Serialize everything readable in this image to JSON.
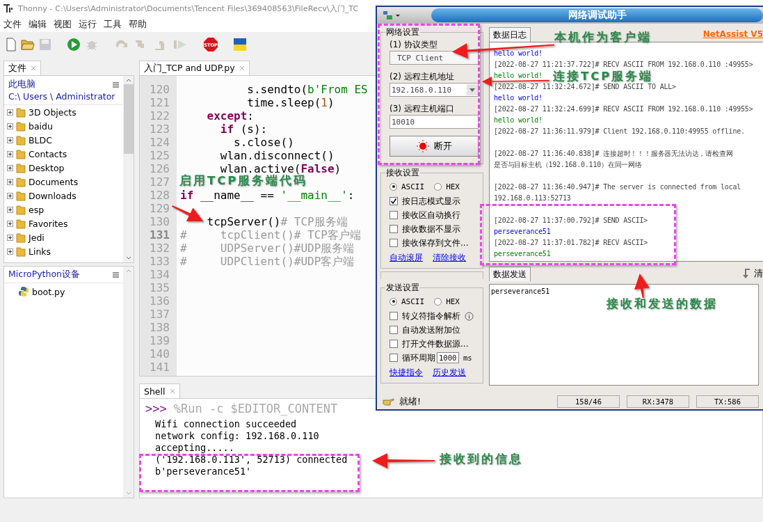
{
  "thonny": {
    "title": "Thonny  -  C:\\Users\\Administrator\\Documents\\Tencent Files\\369408563\\FileRecv\\入门_TC",
    "menu": [
      "文件",
      "编辑",
      "视图",
      "运行",
      "工具",
      "帮助"
    ],
    "toolbar": {
      "stop_label": "STOP"
    },
    "files_panel": {
      "tab": "文件",
      "root": "此电脑",
      "path": "C:\\ Users \\ Administrator",
      "items": [
        "3D Objects",
        "baidu",
        "BLDC",
        "Contacts",
        "Desktop",
        "Documents",
        "Downloads",
        "esp",
        "Favorites",
        "Jedi",
        "Links"
      ]
    },
    "device_panel": {
      "title": "MicroPython设备",
      "items": [
        "boot.py"
      ]
    },
    "editor": {
      "tab": "入门_TCP and UDP.py",
      "lines": [
        {
          "number": "120",
          "current": false,
          "segments": [
            {
              "text": "          s.sendto(",
              "kind": "plain"
            },
            {
              "text": "b'From ES",
              "kind": "string"
            }
          ]
        },
        {
          "number": "121",
          "current": false,
          "segments": [
            {
              "text": "          time.sleep(",
              "kind": "plain"
            },
            {
              "text": "1",
              "kind": "number"
            },
            {
              "text": ")",
              "kind": "plain"
            }
          ]
        },
        {
          "number": "122",
          "current": false,
          "segments": [
            {
              "text": "    except",
              "kind": "keyword"
            },
            {
              "text": ":",
              "kind": "plain"
            }
          ]
        },
        {
          "number": "123",
          "current": false,
          "segments": [
            {
              "text": "      if",
              "kind": "keyword"
            },
            {
              "text": " (s):",
              "kind": "plain"
            }
          ]
        },
        {
          "number": "124",
          "current": false,
          "segments": [
            {
              "text": "        s.close()",
              "kind": "plain"
            }
          ]
        },
        {
          "number": "125",
          "current": false,
          "segments": [
            {
              "text": "      wlan.disconnect()",
              "kind": "plain"
            }
          ]
        },
        {
          "number": "126",
          "current": false,
          "segments": [
            {
              "text": "      wlan.active(",
              "kind": "plain"
            },
            {
              "text": "False",
              "kind": "keyword"
            },
            {
              "text": ")",
              "kind": "plain"
            }
          ]
        },
        {
          "number": "127",
          "current": false
        },
        {
          "number": "128",
          "current": false,
          "segments": [
            {
              "text": "if",
              "kind": "keyword"
            },
            {
              "text": " __name__ == ",
              "kind": "plain"
            },
            {
              "text": "'__main__'",
              "kind": "string"
            },
            {
              "text": ":",
              "kind": "plain"
            }
          ]
        },
        {
          "number": "129",
          "current": false
        },
        {
          "number": "130",
          "current": false,
          "segments": [
            {
              "text": "    tcpServer()",
              "kind": "plain"
            },
            {
              "text": "# TCP服务端",
              "kind": "comment"
            }
          ]
        },
        {
          "number": "131",
          "current": true,
          "segments": [
            {
              "text": "#     tcpClient()# TCP客户端",
              "kind": "comment"
            }
          ]
        },
        {
          "number": "132",
          "current": false,
          "segments": [
            {
              "text": "#     UDPServer()#UDP服务端",
              "kind": "comment"
            }
          ]
        },
        {
          "number": "133",
          "current": false,
          "segments": [
            {
              "text": "#     UDPClient()#UDP客户端",
              "kind": "comment"
            }
          ]
        },
        {
          "number": "134",
          "current": false
        },
        {
          "number": "135",
          "current": false
        },
        {
          "number": "136",
          "current": false
        },
        {
          "number": "137",
          "current": false
        },
        {
          "number": "138",
          "current": false
        },
        {
          "number": "139",
          "current": false
        },
        {
          "number": "140",
          "current": false
        },
        {
          "number": "141",
          "current": false
        }
      ]
    },
    "shell": {
      "tab": "Shell",
      "prompt": ">>>",
      "command": "%Run -c $EDITOR_CONTENT",
      "output": [
        "Wifi connection succeeded",
        "network config: 192.168.0.110",
        "accepting.....",
        "('192.168.0.113', 52713) connected",
        "b'perseverance51'"
      ]
    }
  },
  "netassist": {
    "title": "网络调试助手",
    "net_settings": {
      "legend": "网络设置",
      "protocol_label": "(1) 协议类型",
      "protocol": "TCP Client",
      "host_label": "(2) 远程主机地址",
      "host": "192.168.0.110",
      "port_label": "(3) 远程主机端口",
      "port": "10010",
      "connect_button": "断开"
    },
    "recv_settings": {
      "legend": "接收设置",
      "encodings": [
        {
          "label": "ASCII",
          "selected": true
        },
        {
          "label": "HEX",
          "selected": false
        }
      ],
      "options": [
        {
          "label": "按日志模式显示",
          "checked": true
        },
        {
          "label": "接收区自动换行",
          "checked": false
        },
        {
          "label": "接收数据不显示",
          "checked": false
        },
        {
          "label": "接收保存到文件...",
          "checked": false
        }
      ],
      "links": [
        "自动滚屏",
        "清除接收"
      ]
    },
    "send_settings": {
      "legend": "发送设置",
      "encodings": [
        {
          "label": "ASCII",
          "selected": true
        },
        {
          "label": "HEX",
          "selected": false
        }
      ],
      "options": [
        {
          "label": "转义符指令解析",
          "checked": false,
          "kind": "info"
        },
        {
          "label": "自动发送附加位",
          "checked": false,
          "kind": "plain"
        },
        {
          "label": "打开文件数据源...",
          "checked": false,
          "kind": "plain"
        },
        {
          "label": "循环周期",
          "checked": false,
          "kind": "period",
          "value": "1000",
          "unit": "ms"
        }
      ],
      "links": [
        "快捷指令",
        "历史发送"
      ]
    },
    "log_tab": "数据日志",
    "brand": "NetAssist V5",
    "log": [
      {
        "text": "hello world!",
        "kind": "sent",
        "spaced": false
      },
      {
        "text": "[2022-08-27 11:21:37.722]# RECV ASCII FROM 192.168.0.110 :49955>",
        "kind": "meta",
        "spaced": false
      },
      {
        "text": "hello world!",
        "kind": "recv",
        "spaced": false
      },
      {
        "text": "[2022-08-27 11:32:24.672]# SEND ASCII TO ALL>",
        "kind": "meta",
        "spaced": false
      },
      {
        "text": "hello world!",
        "kind": "sent",
        "spaced": false
      },
      {
        "text": "[2022-08-27 11:32:24.699]# RECV ASCII FROM 192.168.0.110 :49955>",
        "kind": "meta",
        "spaced": false
      },
      {
        "text": "hello world!",
        "kind": "recv",
        "spaced": false
      },
      {
        "text": "[2022-08-27 11:36:11.979]# Client 192.168.0.110:49955 offline.",
        "kind": "meta",
        "spaced": false
      },
      {
        "text": "[2022-08-27 11:36:40.838]# 连接超时！！！服务器无法访达，请检查网",
        "kind": "meta",
        "spaced": true
      },
      {
        "text": "是否与目标主机（192.168.0.110）在同一网络",
        "kind": "meta",
        "spaced": false
      },
      {
        "text": "[2022-08-27 11:36:40.947]# The server is connected from local",
        "kind": "meta",
        "spaced": true
      },
      {
        "text": "192.168.0.113:52713",
        "kind": "meta",
        "spaced": false
      },
      {
        "text": "[2022-08-27 11:37:00.792]# SEND ASCII>",
        "kind": "meta",
        "spaced": true
      },
      {
        "text": "perseverance51",
        "kind": "sent",
        "spaced": false
      },
      {
        "text": "[2022-08-27 11:37:01.782]# RECV ASCII>",
        "kind": "meta",
        "spaced": false
      },
      {
        "text": "perseverance51",
        "kind": "recv",
        "spaced": false
      }
    ],
    "send_tab": "数据发送",
    "clear_label": "清",
    "send_text": "perseverance51",
    "status": {
      "text": "就绪!",
      "counters": [
        "158/46",
        "RX:3478",
        "TX:586"
      ]
    }
  },
  "annotations": [
    {
      "text": "本机作为客户端"
    },
    {
      "text": "连接TCP服务端"
    },
    {
      "text": "启用TCP服务端代码"
    },
    {
      "text": "接收和发送的数据"
    },
    {
      "text": "接收到的信息"
    }
  ]
}
